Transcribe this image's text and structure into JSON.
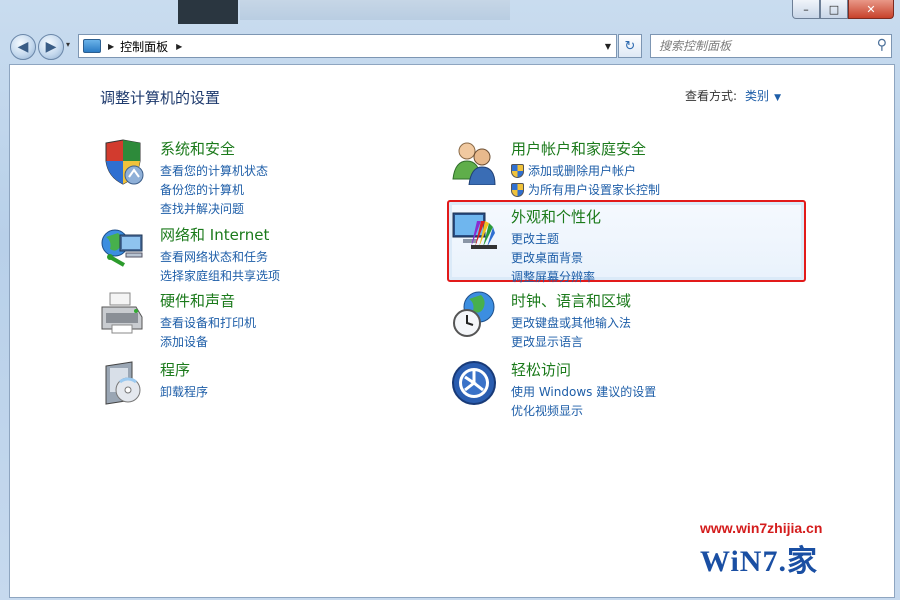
{
  "window": {
    "minimize_glyph": "–",
    "maximize_glyph": "□",
    "close_glyph": "✕"
  },
  "nav": {
    "back_glyph": "◀",
    "forward_glyph": "▶",
    "history_glyph": "▾"
  },
  "address_bar": {
    "separator": "▶",
    "location": "控制面板",
    "separator2": "▶",
    "dropdown_glyph": "▼"
  },
  "refresh_glyph": "↻",
  "search": {
    "placeholder": "搜索控制面板",
    "icon_glyph": "⚲"
  },
  "page": {
    "heading": "调整计算机的设置",
    "view_by_label": "查看方式:",
    "view_by_value": "类别",
    "view_by_arrow": "▼"
  },
  "categories": [
    {
      "title": "系统和安全",
      "icon": "shield-icon",
      "links": [
        "查看您的计算机状态",
        "备份您的计算机",
        "查找并解决问题"
      ]
    },
    {
      "title": "网络和 Internet",
      "icon": "network-globe-icon",
      "links": [
        "查看网络状态和任务",
        "选择家庭组和共享选项"
      ]
    },
    {
      "title": "硬件和声音",
      "icon": "printer-icon",
      "links": [
        "查看设备和打印机",
        "添加设备"
      ]
    },
    {
      "title": "程序",
      "icon": "programs-disc-icon",
      "links": [
        "卸载程序"
      ]
    },
    {
      "title": "用户帐户和家庭安全",
      "icon": "users-icon",
      "links": [
        "添加或删除用户帐户",
        "为所有用户设置家长控制"
      ],
      "link_shields": true
    },
    {
      "title": "外观和个性化",
      "icon": "monitor-palette-icon",
      "links": [
        "更改主题",
        "更改桌面背景",
        "调整屏幕分辨率"
      ],
      "highlighted": true
    },
    {
      "title": "时钟、语言和区域",
      "icon": "clock-globe-icon",
      "links": [
        "更改键盘或其他输入法",
        "更改显示语言"
      ]
    },
    {
      "title": "轻松访问",
      "icon": "ease-of-access-icon",
      "links": [
        "使用 Windows 建议的设置",
        "优化视频显示"
      ]
    }
  ],
  "watermark": {
    "url": "www.win7zhijia.cn",
    "logo": "WiN7.家"
  },
  "colors": {
    "highlight_border": "#e21a1a",
    "category_title": "#1b7a1b",
    "link": "#1e5ea8"
  }
}
